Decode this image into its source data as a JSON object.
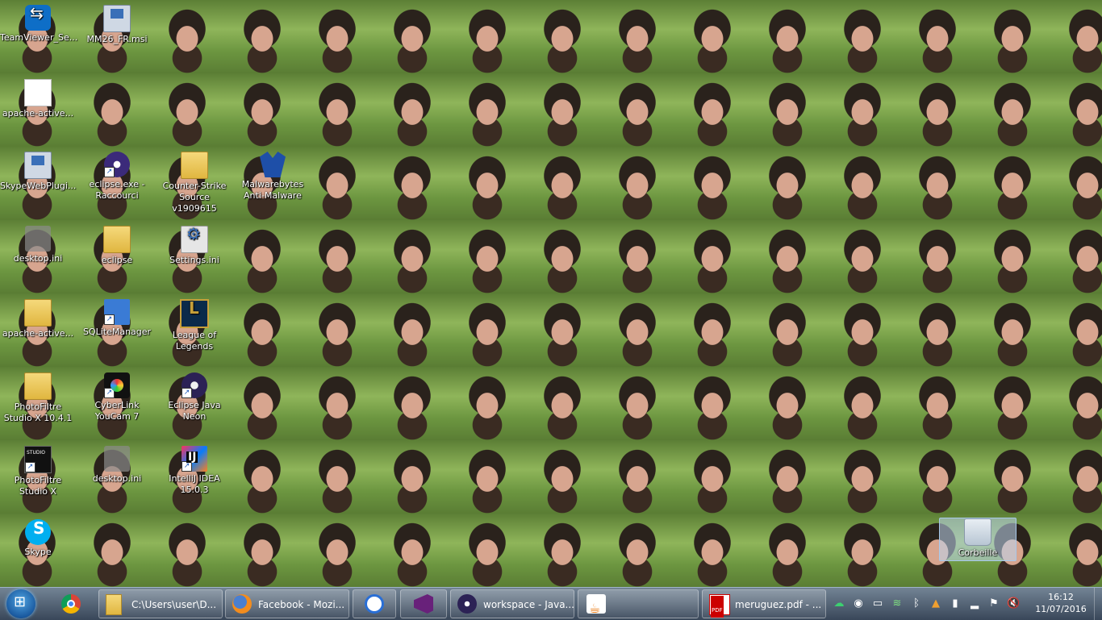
{
  "desktop": {
    "icons": [
      {
        "label": "TeamViewer_Se...",
        "icon": "teamviewer-icon"
      },
      {
        "label": "MM26_FR.msi",
        "icon": "msi-installer-icon"
      },
      {
        "label": "apache-active...",
        "icon": "file-icon"
      },
      {
        "label": "SkypeWebPlugi...",
        "icon": "msi-installer-icon"
      },
      {
        "label": "eclipse.exe -\nRaccourci",
        "icon": "eclipse-icon"
      },
      {
        "label": "Counter-Strike\nSource v1909615",
        "icon": "folder-icon"
      },
      {
        "label": "Malwarebytes\nAnti-Malware",
        "icon": "malwarebytes-icon"
      },
      {
        "label": "desktop.ini",
        "icon": "settings-file-icon"
      },
      {
        "label": "eclipse",
        "icon": "folder-icon"
      },
      {
        "label": "Settings.ini",
        "icon": "settings-file-icon"
      },
      {
        "label": "apache-active...",
        "icon": "folder-icon"
      },
      {
        "label": "SQLiteManager",
        "icon": "sqlitemanager-icon"
      },
      {
        "label": "League of\nLegends",
        "icon": "league-of-legends-icon"
      },
      {
        "label": "PhotoFiltre\nStudio X 10.4.1",
        "icon": "folder-icon"
      },
      {
        "label": "CyberLink\nYouCam 7",
        "icon": "youcam-icon"
      },
      {
        "label": "Eclipse Java Neon",
        "icon": "eclipse-icon"
      },
      {
        "label": "PhotoFiltre\nStudio X",
        "icon": "photofiltre-icon"
      },
      {
        "label": "desktop.ini",
        "icon": "settings-file-icon"
      },
      {
        "label": "IntelliJ IDEA\n15.0.3",
        "icon": "intellij-icon"
      },
      {
        "label": "Skype",
        "icon": "skype-icon"
      },
      {
        "label": "Corbeille",
        "icon": "recycle-bin-icon"
      }
    ]
  },
  "taskbar": {
    "pinned": [
      {
        "name": "chrome",
        "icon": "chrome-icon"
      }
    ],
    "windows": [
      {
        "label": "C:\\Users\\user\\D...",
        "icon": "folder-icon"
      },
      {
        "label": "Facebook - Mozi...",
        "icon": "firefox-icon"
      },
      {
        "label": "",
        "icon": "g-app-icon"
      },
      {
        "label": "",
        "icon": "visual-studio-icon"
      },
      {
        "label": "workspace - Java...",
        "icon": "eclipse-icon"
      },
      {
        "label": "",
        "icon": "java-icon"
      },
      {
        "label": "meruguez.pdf - ...",
        "icon": "pdf-icon"
      }
    ],
    "tray": [
      "cloud-icon",
      "sync-icon",
      "monitor-icon",
      "wifi-icon",
      "bluetooth-icon",
      "security-icon",
      "battery-icon",
      "signal-icon",
      "flag-icon",
      "volume-muted-icon"
    ],
    "clock": {
      "time": "16:12",
      "date": "11/07/2016"
    }
  }
}
